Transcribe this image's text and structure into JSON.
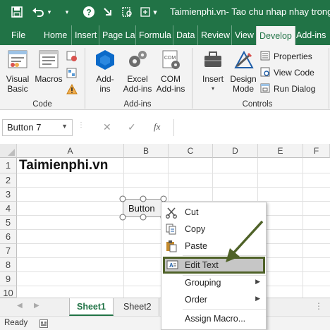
{
  "titlebar": {
    "title": "Taimienphi.vn- Tao chu nhap nhay trong...",
    "quick_access": [
      "save-icon",
      "undo-icon",
      "dropdown-icon",
      "help-icon",
      "redo-icon",
      "print-preview-icon",
      "customize-icon"
    ],
    "bg_color": "#217346"
  },
  "tabs": [
    {
      "label": "File"
    },
    {
      "label": "Home"
    },
    {
      "label": "Insert"
    },
    {
      "label": "Page Lay"
    },
    {
      "label": "Formula"
    },
    {
      "label": "Data"
    },
    {
      "label": "Review"
    },
    {
      "label": "View"
    },
    {
      "label": "Develop",
      "active": true
    },
    {
      "label": "Add-ins"
    }
  ],
  "ribbon": {
    "code_group": {
      "label": "Code",
      "visual_basic": "Visual\nBasic",
      "macros": "Macros"
    },
    "addins_group": {
      "label": "Add-ins",
      "addins": "Add-\nins",
      "excel_addins": "Excel\nAdd-ins",
      "com_addins": "COM\nAdd-ins"
    },
    "controls_group": {
      "label": "Controls",
      "insert": "Insert",
      "design_mode": "Design\nMode",
      "properties": "Properties",
      "view_code": "View Code",
      "run_dialog": "Run Dialog"
    }
  },
  "formula_bar": {
    "name_box": "Button 7",
    "cancel_symbol": "✕",
    "enter_symbol": "✓",
    "fx_symbol": "fx",
    "value": ""
  },
  "grid": {
    "columns": [
      "A",
      "B",
      "C",
      "D",
      "E",
      "F"
    ],
    "rows": [
      "1",
      "2",
      "3",
      "4",
      "5",
      "6",
      "7",
      "8",
      "9",
      "10"
    ],
    "cell_a1": "Taimienphi.vn",
    "button_text": "Button"
  },
  "context_menu": {
    "items": [
      {
        "label": "Cut",
        "icon": "scissors-icon"
      },
      {
        "label": "Copy",
        "icon": "copy-icon"
      },
      {
        "label": "Paste",
        "icon": "paste-icon"
      },
      {
        "label": "Edit Text",
        "icon": "edit-text-icon",
        "highlighted": true
      },
      {
        "label": "Grouping",
        "submenu": true
      },
      {
        "label": "Order",
        "submenu": true
      },
      {
        "label": "Assign Macro..."
      }
    ],
    "highlight_color": "#c6c6c6",
    "highlight_border": "#4f6228"
  },
  "sheets": [
    {
      "label": "Sheet1",
      "active": true
    },
    {
      "label": "Sheet2"
    }
  ],
  "status": {
    "text": "Ready"
  },
  "annotation_arrow_color": "#4f6228"
}
